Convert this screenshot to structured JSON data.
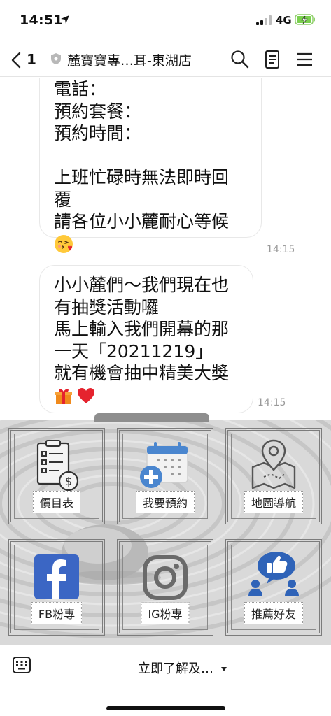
{
  "status_bar": {
    "time": "14:51",
    "network": "4G"
  },
  "header": {
    "back_count": "1",
    "chat_title": "麓寶寶專…耳-東湖店"
  },
  "messages": [
    {
      "lines": [
        "電話：",
        "預約套餐：",
        "預約時間：",
        "",
        "上班忙碌時無法即時回",
        "覆",
        "請各位小小麓耐心等候"
      ],
      "emojis": [
        "face-blowing-kiss-emoji"
      ],
      "time": "14:15"
    },
    {
      "lines": [
        "小小麓們～我們現在也",
        "有抽獎活動囉",
        "馬上輸入我們開幕的那",
        "一天「20211219」",
        "就有機會抽中精美大獎"
      ],
      "emojis": [
        "gift-emoji",
        "red-heart-emoji"
      ],
      "time": "14:15"
    }
  ],
  "rich_menu": {
    "tiles": [
      {
        "label": "價目表",
        "icon": "price-list-icon"
      },
      {
        "label": "我要預約",
        "icon": "calendar-add-icon"
      },
      {
        "label": "地圖導航",
        "icon": "map-pin-icon"
      },
      {
        "label": "FB粉專",
        "icon": "facebook-icon"
      },
      {
        "label": "IG粉專",
        "icon": "instagram-icon"
      },
      {
        "label": "推薦好友",
        "icon": "thumbs-up-friends-icon"
      }
    ],
    "colors": {
      "facebook_blue": "#3b66c4",
      "calendar_blue": "#4a86cf"
    }
  },
  "bottom_bar": {
    "menu_toggle_label": "立即了解及…"
  }
}
